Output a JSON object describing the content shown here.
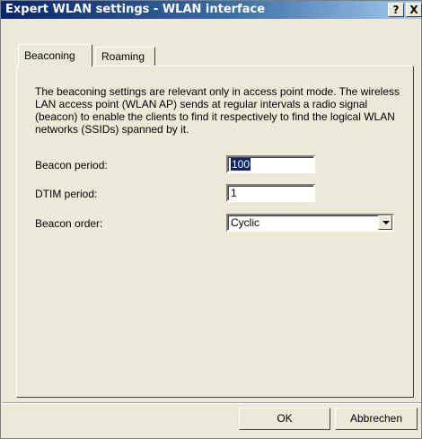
{
  "window": {
    "title": "Expert WLAN settings - WLAN interface",
    "help_label": "?",
    "close_label": "X"
  },
  "tabs": [
    {
      "label": "Beaconing",
      "active": true
    },
    {
      "label": "Roaming",
      "active": false
    }
  ],
  "beaconing": {
    "description": "The beaconing settings are relevant only in access point mode. The wireless LAN access point (WLAN AP) sends at regular intervals a radio signal (beacon) to enable the clients to find it respectively to find the logical WLAN networks (SSIDs) spanned by it.",
    "beacon_period_label": "Beacon period:",
    "beacon_period_value": "100",
    "dtim_period_label": "DTIM period:",
    "dtim_period_value": "1",
    "beacon_order_label": "Beacon order:",
    "beacon_order_value": "Cyclic"
  },
  "buttons": {
    "ok": "OK",
    "cancel": "Abbrechen"
  }
}
